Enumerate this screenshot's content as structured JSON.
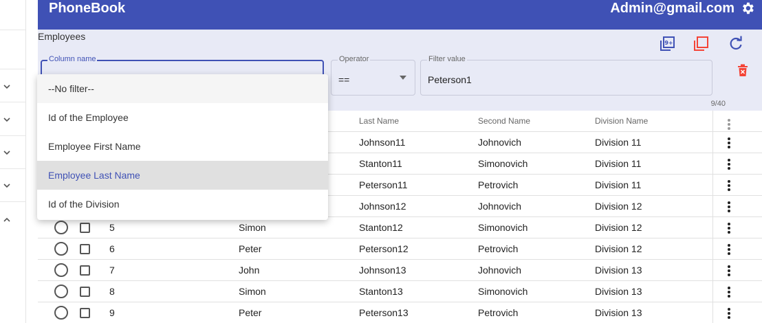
{
  "app": {
    "title": "PhoneBook",
    "user_email": "Admin@gmail.com"
  },
  "page": {
    "title": "Employees"
  },
  "filter": {
    "column": {
      "label": "Column name",
      "value": ""
    },
    "operator": {
      "label": "Operator",
      "value": "=="
    },
    "value": {
      "label": "Filter value",
      "value": "Peterson1",
      "counter": "9/40"
    }
  },
  "toolbar": {
    "icons": [
      "library-add-icon",
      "copy-icon",
      "refresh-icon"
    ],
    "accent": "#3f51b5",
    "danger": "#f44336"
  },
  "dropdown": {
    "options": [
      "--No filter--",
      "Id of the Employee",
      "Employee First Name",
      "Employee Last Name",
      "Id of the Division"
    ],
    "selected": "Employee Last Name"
  },
  "table": {
    "headers": {
      "last_name": "Last Name",
      "second_name": "Second Name",
      "division": "Division Name"
    },
    "rows": [
      {
        "id": "",
        "first": "",
        "last": "Johnson11",
        "second": "Johnovich",
        "division": "Division 11"
      },
      {
        "id": "",
        "first": "",
        "last": "Stanton11",
        "second": "Simonovich",
        "division": "Division 11"
      },
      {
        "id": "",
        "first": "",
        "last": "Peterson11",
        "second": "Petrovich",
        "division": "Division 11"
      },
      {
        "id": "",
        "first": "",
        "last": "Johnson12",
        "second": "Johnovich",
        "division": "Division 12"
      },
      {
        "id": "5",
        "first": "Simon",
        "last": "Stanton12",
        "second": "Simonovich",
        "division": "Division 12"
      },
      {
        "id": "6",
        "first": "Peter",
        "last": "Peterson12",
        "second": "Petrovich",
        "division": "Division 12"
      },
      {
        "id": "7",
        "first": "John",
        "last": "Johnson13",
        "second": "Johnovich",
        "division": "Division 13"
      },
      {
        "id": "8",
        "first": "Simon",
        "last": "Stanton13",
        "second": "Simonovich",
        "division": "Division 13"
      },
      {
        "id": "9",
        "first": "Peter",
        "last": "Peterson13",
        "second": "Petrovich",
        "division": "Division 13"
      }
    ]
  },
  "colors": {
    "header_bg": "#3f51b5",
    "filter_bg": "#e8eaf6"
  }
}
